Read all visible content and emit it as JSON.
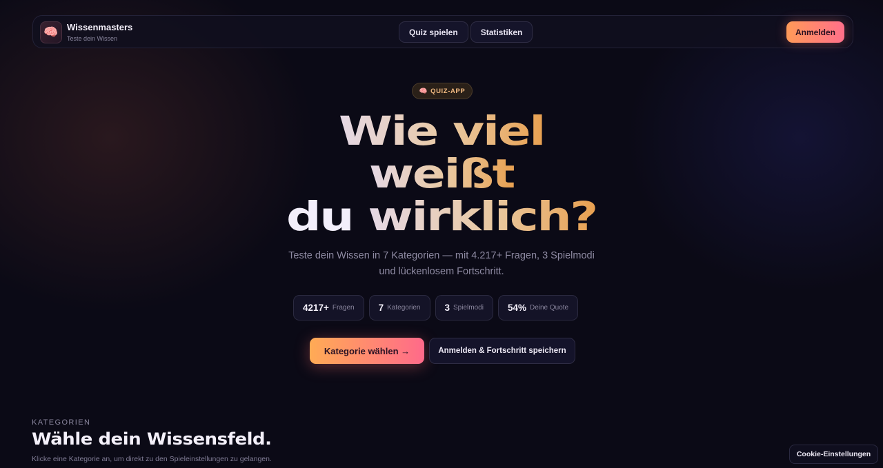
{
  "nav": {
    "brand_title": "Wissenmasters",
    "brand_subtitle": "Teste dein Wissen",
    "logo_icon": "🧠",
    "tabs": [
      {
        "label": "Quiz spielen"
      },
      {
        "label": "Statistiken"
      }
    ],
    "login_label": "Anmelden"
  },
  "hero": {
    "badge_icon": "🧠",
    "badge_label": "QUIZ-APP",
    "line1": "Wie viel",
    "line2": "weißt",
    "line3_a": "du ",
    "line3_b": "wirklich?",
    "subtitle_1": "Teste dein Wissen in 7 Kategorien — mit 4.217+ Fragen, 3 Spielmodi",
    "subtitle_2": "und lückenlosem Fortschritt."
  },
  "stats": [
    {
      "value": "4217+",
      "label": "Fragen"
    },
    {
      "value": "7",
      "label": "Kategorien"
    },
    {
      "value": "3",
      "label": "Spielmodi"
    },
    {
      "value": "54%",
      "label": "Deine Quote"
    }
  ],
  "cta": {
    "primary": "Kategorie wählen →",
    "secondary": "Anmelden & Fortschritt speichern"
  },
  "section": {
    "eyebrow": "KATEGORIEN",
    "title": "Wähle dein Wissensfeld.",
    "subtitle": "Klicke eine Kategorie an, um direkt zu den Spieleinstellungen zu gelangen."
  },
  "cookie_label": "Cookie-Einstellungen",
  "colors": {
    "background": "#0b0a16",
    "accent_orange": "#ff9a58",
    "accent_pink": "#ff6f8a"
  }
}
